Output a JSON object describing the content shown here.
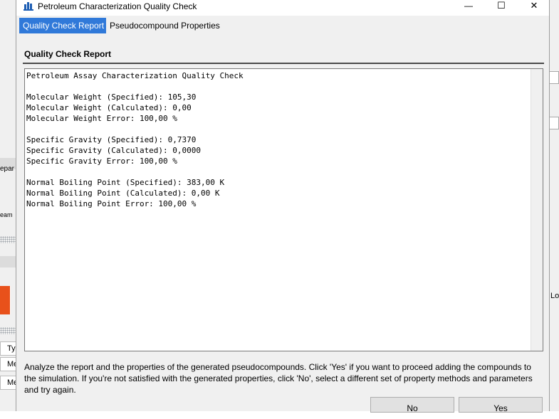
{
  "window": {
    "title": "Petroleum Characterization Quality Check",
    "controls": {
      "minimize": "—",
      "maximize": "☐",
      "close": "✕"
    }
  },
  "tabs": [
    {
      "label": "Quality Check Report",
      "active": true
    },
    {
      "label": "Pseudocompound Properties",
      "active": false
    }
  ],
  "section": {
    "title": "Quality Check Report"
  },
  "report": {
    "text": "Petroleum Assay Characterization Quality Check\n\nMolecular Weight (Specified): 105,30\nMolecular Weight (Calculated): 0,00\nMolecular Weight Error: 100,00 %\n\nSpecific Gravity (Specified): 0,7370\nSpecific Gravity (Calculated): 0,0000\nSpecific Gravity Error: 100,00 %\n\nNormal Boiling Point (Specified): 383,00 K\nNormal Boiling Point (Calculated): 0,00 K\nNormal Boiling Point Error: 100,00 %"
  },
  "info_text": "Analyze the report and the properties of the generated pseudocompounds. Click 'Yes' if you want to proceed adding the compounds to the simulation. If you're not satisfied with the generated properties, click 'No', select a different set of property methods and parameters and try again.",
  "buttons": {
    "no": "No",
    "yes": "Yes"
  },
  "background_app": {
    "left_fragments": [
      "epar",
      "eam",
      "Ty",
      "Me",
      "Me"
    ],
    "right_fragments": [
      "Lo"
    ]
  },
  "colors": {
    "accent": "#3079d9",
    "dialog_bg": "#f0f0f0",
    "alert": "#e8511b"
  }
}
